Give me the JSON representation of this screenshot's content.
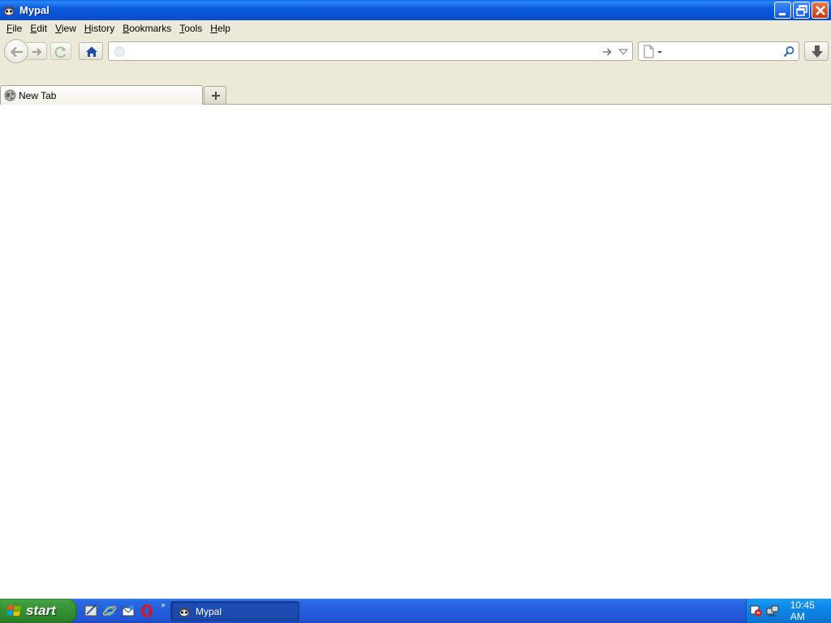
{
  "window": {
    "title": "Mypal",
    "controls": [
      "minimize-icon",
      "restore-icon",
      "close-icon"
    ]
  },
  "menubar": {
    "items": [
      {
        "label": "File",
        "underline": "F"
      },
      {
        "label": "Edit",
        "underline": "E"
      },
      {
        "label": "View",
        "underline": "V"
      },
      {
        "label": "History",
        "underline": "H"
      },
      {
        "label": "Bookmarks",
        "underline": "B"
      },
      {
        "label": "Tools",
        "underline": "T"
      },
      {
        "label": "Help",
        "underline": "H"
      }
    ]
  },
  "navbar": {
    "url": {
      "value": "",
      "placeholder": ""
    },
    "search": {
      "value": "",
      "placeholder": ""
    },
    "icons": [
      "back-icon",
      "forward-icon",
      "reload-icon",
      "home-icon",
      "go-arrow-icon",
      "history-dropdown-icon",
      "search-engine-icon",
      "search-icon",
      "download-icon"
    ]
  },
  "tabs": [
    {
      "label": "New Tab",
      "icon": "globe-icon"
    }
  ],
  "taskbar": {
    "start_label": "start",
    "quick_launch": [
      "show-desktop-icon",
      "internet-explorer-icon",
      "outlook-express-icon",
      "opera-icon"
    ],
    "tasks": [
      {
        "label": "Mypal",
        "icon": "mypal-icon"
      }
    ],
    "tray_icons": [
      "clock-tray-icon",
      "network-tray-icon"
    ],
    "clock": "10:45 AM"
  },
  "colors": {
    "titlebar": "#0a5fe6",
    "chrome": "#ece9d8",
    "taskbar": "#245ddb",
    "start": "#3c9a3c",
    "tray": "#0f8bea"
  }
}
